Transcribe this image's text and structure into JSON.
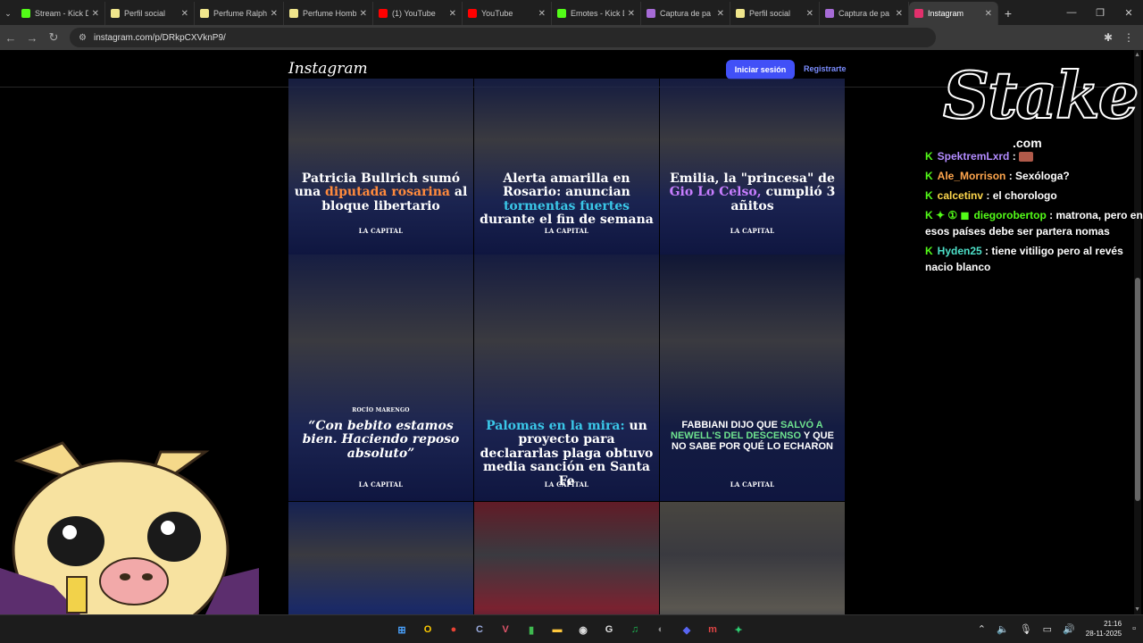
{
  "tabs": [
    {
      "label": "Stream - Kick D",
      "favicon_color": "#53fc18"
    },
    {
      "label": "Perfil social",
      "favicon_color": "#f0e68c"
    },
    {
      "label": "Perfume Ralph",
      "favicon_color": "#f0e68c"
    },
    {
      "label": "Perfume Homb",
      "favicon_color": "#f0e68c"
    },
    {
      "label": "(1) YouTube",
      "favicon_color": "#ff0000"
    },
    {
      "label": "YouTube",
      "favicon_color": "#ff0000"
    },
    {
      "label": "Emotes - Kick D",
      "favicon_color": "#53fc18"
    },
    {
      "label": "Captura de pa",
      "favicon_color": "#a66bd6"
    },
    {
      "label": "Perfil social",
      "favicon_color": "#f0e68c"
    },
    {
      "label": "Captura de pa",
      "favicon_color": "#a66bd6"
    },
    {
      "label": "Instagram",
      "favicon_color": "#e1306c"
    }
  ],
  "address": {
    "url": "instagram.com/p/DRkpCXVknP9/"
  },
  "instagram": {
    "logo": "Instagram",
    "login_label": "Iniciar sesión",
    "signup_label": "Registrarte"
  },
  "posts": [
    {
      "caption_parts": [
        {
          "t": "Patricia Bullrich sumó una "
        },
        {
          "t": "diputada rosarina",
          "hl": "orange"
        },
        {
          "t": " al bloque libertario"
        }
      ],
      "brand": "LA CAPITAL",
      "bg": "#1b2450",
      "style": "serif"
    },
    {
      "caption_parts": [
        {
          "t": "Alerta amarilla en Rosario: anuncian "
        },
        {
          "t": "tormentas fuertes",
          "hl": "cyan"
        },
        {
          "t": " durante el fin de semana"
        }
      ],
      "brand": "LA CAPITAL",
      "bg": "#1a2350",
      "style": "serif"
    },
    {
      "caption_parts": [
        {
          "t": "Emilia, la \"princesa\" de "
        },
        {
          "t": "Gio Lo Celso,",
          "hl": "purple"
        },
        {
          "t": " cumplió 3 añitos"
        }
      ],
      "brand": "LA CAPITAL",
      "bg": "#1a2250",
      "style": "serif"
    },
    {
      "caption_parts": [
        {
          "t": "“Con bebito estamos bien. Haciendo reposo absoluto”"
        }
      ],
      "brand": "LA CAPITAL",
      "credit": "ROCÍO MARENGO",
      "bg": "#1c2552",
      "style": "serif-italic"
    },
    {
      "caption_parts": [
        {
          "t": "Palomas en la mira:",
          "hl": "cyan"
        },
        {
          "t": " un proyecto para declararlas plaga obtuvo media sanción en Santa Fe"
        }
      ],
      "brand": "LA CAPITAL",
      "bg": "#1b2350",
      "style": "serif"
    },
    {
      "caption_parts": [
        {
          "t": "FABBIANI DIJO QUE "
        },
        {
          "t": "SALVÓ A NEWELL'S DEL DESCENSO",
          "hl": "green"
        },
        {
          "t": " Y QUE NO SABE POR QUÉ LO ECHARON"
        }
      ],
      "brand": "LA CAPITAL",
      "bg": "#141c42",
      "style": "sans"
    },
    {
      "caption_parts": [],
      "brand": "",
      "bg": "#1b2a66",
      "style": "serif"
    },
    {
      "caption_parts": [],
      "brand": "",
      "bg": "#7a2230",
      "style": "serif"
    },
    {
      "caption_parts": [],
      "brand": "",
      "bg": "#5a5750",
      "style": "serif"
    }
  ],
  "chat": [
    {
      "user": "SpektremLxrd",
      "text": "",
      "color": "#b38cff",
      "badges": "K"
    },
    {
      "user": "Ale_Morrison",
      "text": "Sexóloga?",
      "color": "#ffa64d",
      "badges": "K"
    },
    {
      "user": "calcetinv",
      "text": "el chorologo",
      "color": "#ffd84d",
      "badges": "K"
    },
    {
      "user": "diegorobertop",
      "text": "matrona, pero en esos países debe ser partera nomas",
      "color": "#53fc18",
      "badges": "K ✦ ① ◼"
    },
    {
      "user": "Hyden25",
      "text": "tiene vitiligo pero al revés nacio blanco",
      "color": "#4de0c8",
      "badges": "K"
    }
  ],
  "overlay": {
    "stake_word": "Stake",
    "stake_com": ".com"
  },
  "taskbar": {
    "icons": [
      {
        "name": "windows-start-icon",
        "glyph": "⊞",
        "color": "#4aa3ff"
      },
      {
        "name": "opera-icon",
        "glyph": "O",
        "color": "#ffcc00"
      },
      {
        "name": "chrome-icon",
        "glyph": "●",
        "color": "#e94335"
      },
      {
        "name": "app-c-icon",
        "glyph": "C",
        "color": "#9ad"
      },
      {
        "name": "app-v-icon",
        "glyph": "V",
        "color": "#e0556b"
      },
      {
        "name": "app-b-icon",
        "glyph": "▮",
        "color": "#3fb950"
      },
      {
        "name": "file-explorer-icon",
        "glyph": "▬",
        "color": "#ffc83d"
      },
      {
        "name": "obs-icon",
        "glyph": "◉",
        "color": "#ddd"
      },
      {
        "name": "github-icon",
        "glyph": "G",
        "color": "#ddd"
      },
      {
        "name": "spotify-icon",
        "glyph": "♫",
        "color": "#1db954"
      },
      {
        "name": "app-dark-icon",
        "glyph": "◐",
        "color": "#888"
      },
      {
        "name": "discord-icon",
        "glyph": "◆",
        "color": "#5865f2"
      },
      {
        "name": "app-m-icon",
        "glyph": "m",
        "color": "#e04545"
      },
      {
        "name": "app-green-icon",
        "glyph": "✦",
        "color": "#2ecc71"
      }
    ],
    "time": "21:16",
    "date": "28-11-2025"
  }
}
